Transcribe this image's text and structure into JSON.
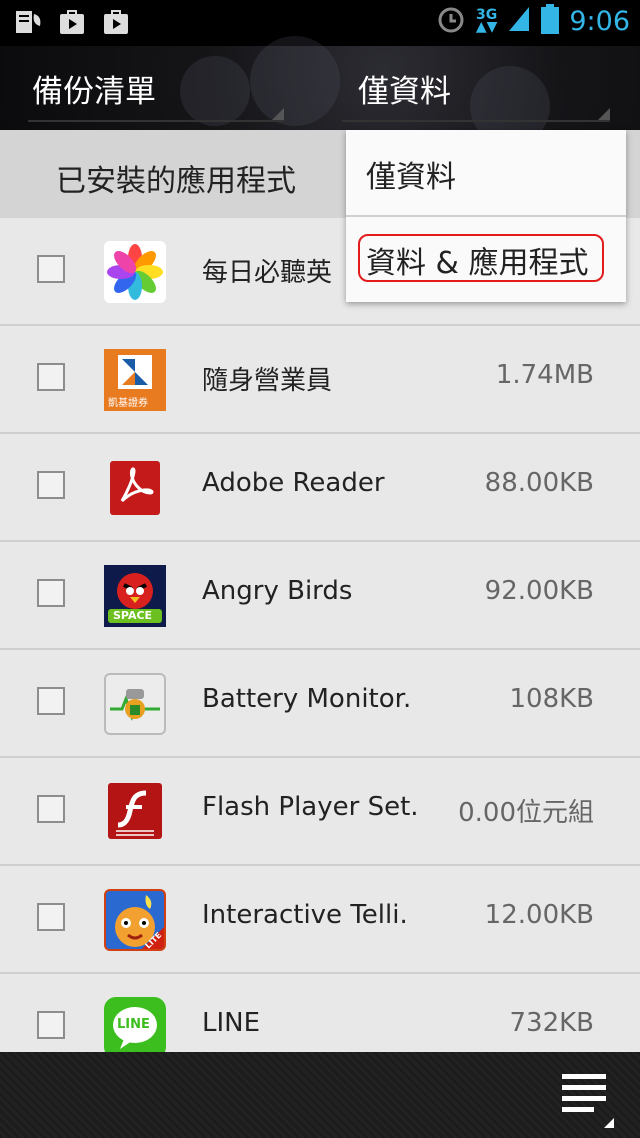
{
  "status_bar": {
    "time": "9:06",
    "network": "3G"
  },
  "action_bar": {
    "title": "備份清單",
    "spinner_selected": "僅資料"
  },
  "section": {
    "title": "已安裝的應用程式"
  },
  "apps": [
    {
      "name": "每日必聽英",
      "size": "",
      "icon": "flower-icon"
    },
    {
      "name": "隨身營業員",
      "size": "1.74MB",
      "icon": "kgi-icon",
      "icon_label": "凱基證券"
    },
    {
      "name": "Adobe Reader",
      "size": "88.00KB",
      "icon": "adobe-reader-icon"
    },
    {
      "name": "Angry Birds",
      "size": "92.00KB",
      "icon": "angry-birds-icon",
      "icon_label": "SPACE"
    },
    {
      "name": "Battery Monitor.",
      "size": "108KB",
      "icon": "battery-monitor-icon"
    },
    {
      "name": "Flash Player Set.",
      "size": "0.00位元組",
      "icon": "flash-player-icon"
    },
    {
      "name": "Interactive Telli.",
      "size": "12.00KB",
      "icon": "interactive-telling-icon",
      "icon_label": "LITE"
    },
    {
      "name": "LINE",
      "size": "732KB",
      "icon": "line-icon",
      "icon_label": "LINE"
    }
  ],
  "dropdown": {
    "options": [
      "僅資料",
      "資料 & 應用程式"
    ],
    "highlighted_option": "資料 & 應用程式"
  },
  "colors": {
    "accent": "#33b5e5",
    "highlight": "#e21b1b"
  }
}
